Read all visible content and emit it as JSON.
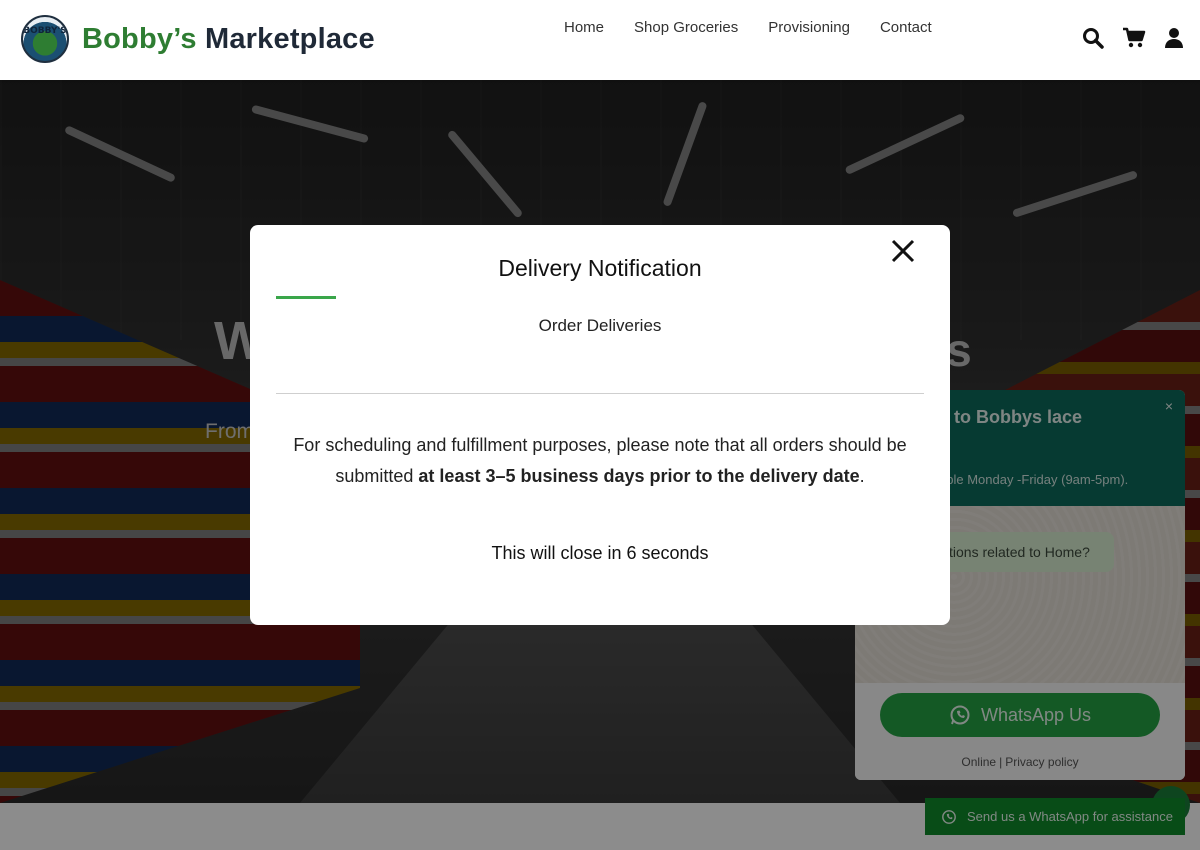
{
  "header": {
    "logo_text": "BOBBY'S",
    "brand_part1": "Bobby’s",
    "brand_part2": "Marketplace",
    "nav": [
      "Home",
      "Shop Groceries",
      "Provisioning",
      "Contact"
    ],
    "icons": [
      "search-icon",
      "cart-icon",
      "user-icon"
    ]
  },
  "hero": {
    "title_left": "W",
    "title_right": "os",
    "subtitle": "From"
  },
  "whatsapp": {
    "title": "e to Bobbys lace",
    "availability": "able Monday -Friday (9am-5pm).",
    "bubble": "tions related to Home?",
    "button": "WhatsApp Us",
    "online": "Online",
    "separator": "|",
    "privacy": "Privacy policy",
    "strip": "Send us a WhatsApp for assistance",
    "close": "×"
  },
  "modal": {
    "title": "Delivery Notification",
    "subtitle": "Order Deliveries",
    "body_pre": "For scheduling and fulfillment purposes, please note that all orders should be submitted ",
    "body_bold": "at least 3–5 business days prior to the delivery date",
    "body_post": ".",
    "countdown": "This will close in 6 seconds"
  },
  "colors": {
    "brand_green": "#2e7d32",
    "whatsapp_green": "#25a244",
    "whatsapp_header": "#0b6b5b",
    "accent_line": "#3aa64a"
  }
}
